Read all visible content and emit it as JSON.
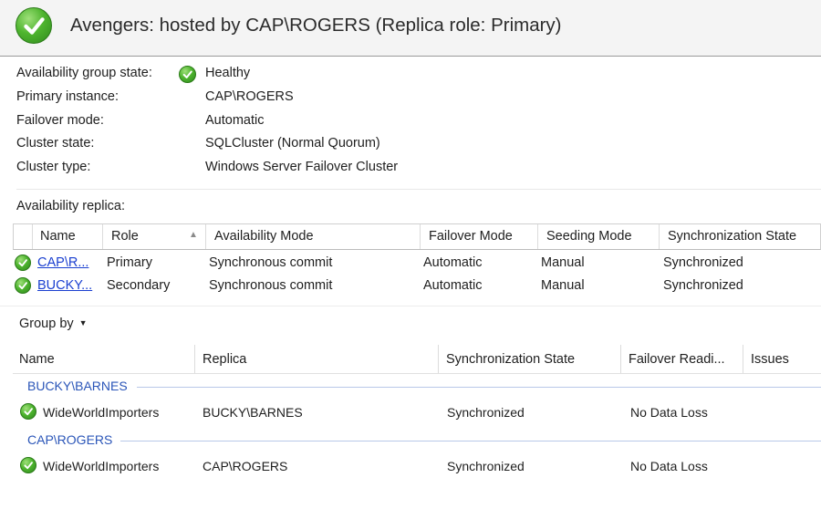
{
  "header": {
    "title": "Avengers: hosted by CAP\\ROGERS (Replica role: Primary)",
    "status_icon": "ok-check-icon",
    "accent_color": "#4fb52f"
  },
  "summary": [
    {
      "label": "Availability group state:",
      "value": "Healthy",
      "icon": "ok-check-icon"
    },
    {
      "label": "Primary instance:",
      "value": "CAP\\ROGERS"
    },
    {
      "label": "Failover mode:",
      "value": "Automatic"
    },
    {
      "label": "Cluster state:",
      "value": "SQLCluster (Normal Quorum)"
    },
    {
      "label": "Cluster type:",
      "value": "Windows Server Failover Cluster"
    }
  ],
  "replicas": {
    "label": "Availability replica:",
    "columns": [
      "Name",
      "Role",
      "Availability Mode",
      "Failover Mode",
      "Seeding Mode",
      "Synchronization State"
    ],
    "rows": [
      {
        "name": "CAP\\R...",
        "role": "Primary",
        "availability_mode": "Synchronous commit",
        "failover_mode": "Automatic",
        "seeding_mode": "Manual",
        "sync_state": "Synchronized"
      },
      {
        "name": "BUCKY...",
        "role": "Secondary",
        "availability_mode": "Synchronous commit",
        "failover_mode": "Automatic",
        "seeding_mode": "Manual",
        "sync_state": "Synchronized"
      }
    ]
  },
  "databases": {
    "group_by_label": "Group by",
    "columns": [
      "Name",
      "Replica",
      "Synchronization State",
      "Failover Readi...",
      "Issues"
    ],
    "groups": [
      {
        "name": "BUCKY\\BARNES",
        "rows": [
          {
            "name": "WideWorldImporters",
            "replica": "BUCKY\\BARNES",
            "sync_state": "Synchronized",
            "failover_readiness": "No Data Loss",
            "issues": ""
          }
        ]
      },
      {
        "name": "CAP\\ROGERS",
        "rows": [
          {
            "name": "WideWorldImporters",
            "replica": "CAP\\ROGERS",
            "sync_state": "Synchronized",
            "failover_readiness": "No Data Loss",
            "issues": ""
          }
        ]
      }
    ]
  }
}
